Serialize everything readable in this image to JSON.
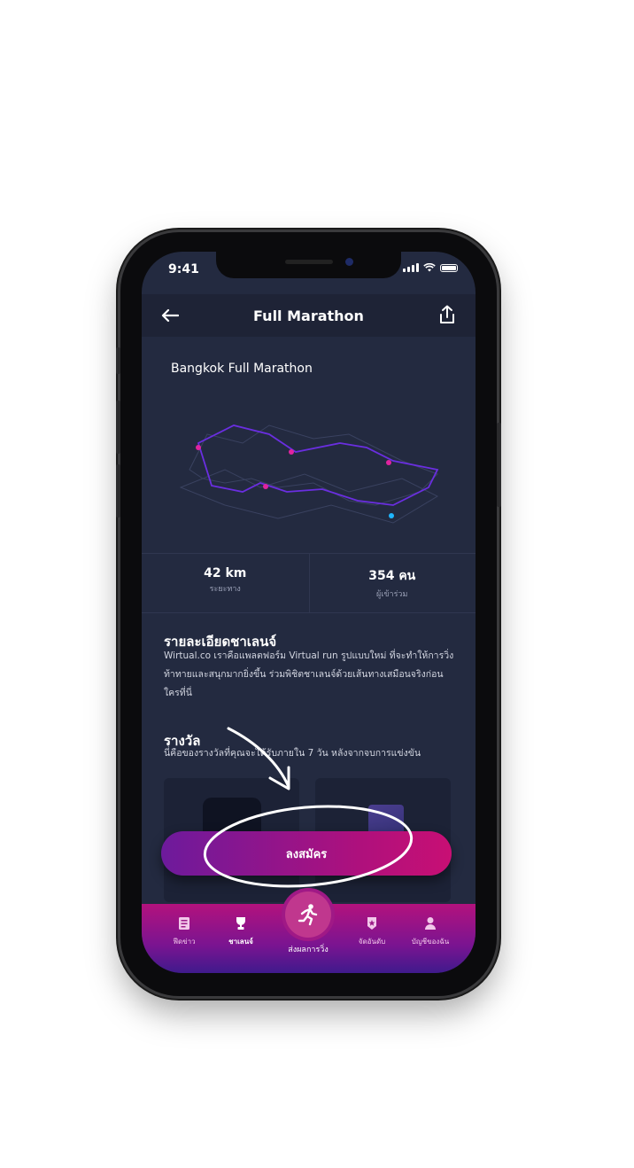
{
  "status_bar": {
    "time": "9:41"
  },
  "header": {
    "title": "Full Marathon"
  },
  "route": {
    "name": "Bangkok Full Marathon"
  },
  "stats": [
    {
      "value": "42 km",
      "label": "ระยะทาง"
    },
    {
      "value": "354 คน",
      "label": "ผู้เข้าร่วม"
    }
  ],
  "details": {
    "heading": "รายละเอียดชาเลนจ์",
    "body": "Wirtual.co เราคือแพลตฟอร์ม Virtual run รูปแบบใหม่ ที่จะทำให้การวิ่งท้าทายและสนุกมากยิ่งขึ้น ร่วมพิชิตชาเลนจ์ด้วยเส้นทางเสมือนจริงก่อนใครที่นี่"
  },
  "rewards": {
    "heading": "รางวัล",
    "body": "นี่คือของรางวัลที่คุณจะได้รับภายใน 7 วัน หลังจากจบการแข่งขัน"
  },
  "register_button": {
    "label": "ลงสมัคร"
  },
  "tabbar": {
    "tabs": [
      {
        "label": "ฟีดข่าว",
        "icon": "news-icon"
      },
      {
        "label": "ชาเลนจ์",
        "icon": "trophy-icon"
      },
      {
        "label": "ส่งผลการวิ่ง",
        "icon": "runner-icon"
      },
      {
        "label": "จัดอันดับ",
        "icon": "rank-badge-icon"
      },
      {
        "label": "บัญชีของฉัน",
        "icon": "user-icon"
      }
    ]
  },
  "colors": {
    "accent": "#c80f74",
    "background": "#232a40",
    "route_line": "#6a2ee0"
  }
}
